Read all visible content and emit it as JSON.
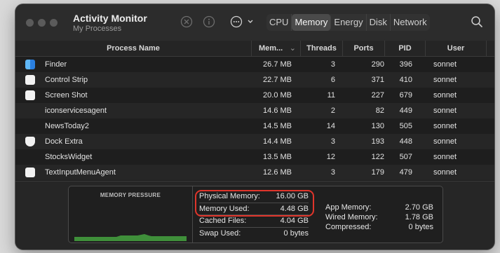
{
  "app": {
    "title": "Activity Monitor",
    "subtitle": "My Processes"
  },
  "tabs": [
    {
      "label": "CPU",
      "active": false
    },
    {
      "label": "Memory",
      "active": true
    },
    {
      "label": "Energy",
      "active": false
    },
    {
      "label": "Disk",
      "active": false
    },
    {
      "label": "Network",
      "active": false
    }
  ],
  "columns": {
    "name": "Process Name",
    "memory": "Mem...",
    "threads": "Threads",
    "ports": "Ports",
    "pid": "PID",
    "user": "User"
  },
  "rows": [
    {
      "name": "Finder",
      "icon": "finder-icon",
      "memory": "26.7 MB",
      "threads": "3",
      "ports": "290",
      "pid": "396",
      "user": "sonnet"
    },
    {
      "name": "Control Strip",
      "icon": "app-icon",
      "memory": "22.7 MB",
      "threads": "6",
      "ports": "371",
      "pid": "410",
      "user": "sonnet"
    },
    {
      "name": "Screen Shot",
      "icon": "app-icon",
      "memory": "20.0 MB",
      "threads": "11",
      "ports": "227",
      "pid": "679",
      "user": "sonnet"
    },
    {
      "name": "iconservicesagent",
      "icon": "",
      "memory": "14.6 MB",
      "threads": "2",
      "ports": "82",
      "pid": "449",
      "user": "sonnet"
    },
    {
      "name": "NewsToday2",
      "icon": "",
      "memory": "14.5 MB",
      "threads": "14",
      "ports": "130",
      "pid": "505",
      "user": "sonnet"
    },
    {
      "name": "Dock Extra",
      "icon": "shield-icon",
      "memory": "14.4 MB",
      "threads": "3",
      "ports": "193",
      "pid": "448",
      "user": "sonnet"
    },
    {
      "name": "StocksWidget",
      "icon": "",
      "memory": "13.5 MB",
      "threads": "12",
      "ports": "122",
      "pid": "507",
      "user": "sonnet"
    },
    {
      "name": "TextInputMenuAgent",
      "icon": "app-icon",
      "memory": "12.6 MB",
      "threads": "3",
      "ports": "179",
      "pid": "479",
      "user": "sonnet"
    }
  ],
  "memory_pressure": {
    "title": "MEMORY PRESSURE",
    "color": "#3f8f3a"
  },
  "memory_stats": [
    {
      "label": "Physical Memory:",
      "value": "16.00 GB"
    },
    {
      "label": "Memory Used:",
      "value": "4.48 GB"
    },
    {
      "label": "Cached Files:",
      "value": "4.04 GB"
    },
    {
      "label": "Swap Used:",
      "value": "0 bytes"
    }
  ],
  "memory_breakdown": [
    {
      "label": "App Memory:",
      "value": "2.70 GB"
    },
    {
      "label": "Wired Memory:",
      "value": "1.78 GB"
    },
    {
      "label": "Compressed:",
      "value": "0 bytes"
    }
  ],
  "highlight_color": "#e0352b"
}
